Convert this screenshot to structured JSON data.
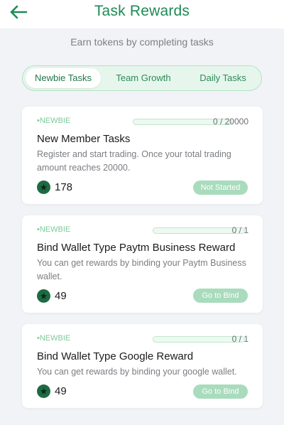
{
  "header": {
    "title": "Task Rewards",
    "back_icon": "arrow-left-icon"
  },
  "subtitle": "Earn tokens by completing tasks",
  "tabs": [
    {
      "label": "Newbie Tasks",
      "active": true
    },
    {
      "label": "Team Growth",
      "active": false
    },
    {
      "label": "Daily Tasks",
      "active": false
    }
  ],
  "colors": {
    "brand": "#1e8a55",
    "accent_light": "#a9dbbd",
    "coin": "#1e6b43"
  },
  "tasks": [
    {
      "tag": "•NEWBIE",
      "progress_text": "0 / 20000",
      "progress_fraction": 0,
      "title": "New Member Tasks",
      "description": "Register and start trading. Once your total trading amount reaches 20000.",
      "reward": "178",
      "coin_icon": "star-coin-icon",
      "button": "Not Started"
    },
    {
      "tag": "•NEWBIE",
      "progress_text": "0 / 1",
      "progress_fraction": 0,
      "title": "Bind Wallet Type Paytm Business Reward",
      "description": "You can get rewards by binding your Paytm Business wallet.",
      "reward": "49",
      "coin_icon": "star-coin-icon",
      "button": "Go to Bind"
    },
    {
      "tag": "•NEWBIE",
      "progress_text": "0 / 1",
      "progress_fraction": 0,
      "title": "Bind Wallet Type Google Reward",
      "description": "You can get rewards by binding your google wallet.",
      "reward": "49",
      "coin_icon": "star-coin-icon",
      "button": "Go to Bind"
    }
  ]
}
